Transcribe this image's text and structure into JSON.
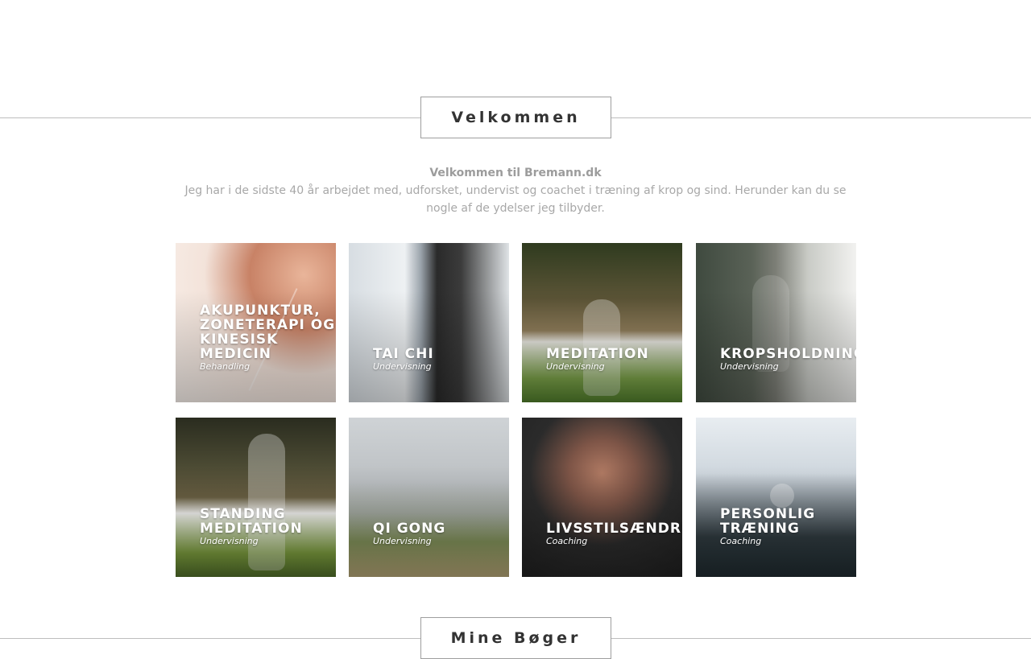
{
  "welcome": {
    "heading": "Velkommen",
    "lead": "Velkommen til Bremann.dk",
    "text": "Jeg har i de sidste 40 år arbejdet med, udforsket, undervist og coachet i træning af krop og sind. Herunder kan du se nogle af de ydelser jeg tilbyder."
  },
  "services": [
    {
      "title": "AKUPUNKTUR,\nZONETERAPI OG\nKINESISK\nMEDICIN",
      "subtitle": "Behandling"
    },
    {
      "title": "TAI CHI",
      "subtitle": "Undervisning"
    },
    {
      "title": "MEDITATION",
      "subtitle": "Undervisning"
    },
    {
      "title": "KROPSHOLDNING",
      "subtitle": "Undervisning"
    },
    {
      "title": "STANDING\nMEDITATION",
      "subtitle": "Undervisning"
    },
    {
      "title": "QI GONG",
      "subtitle": "Undervisning"
    },
    {
      "title": "LIVSSTILSÆNDRINGER",
      "subtitle": "Coaching"
    },
    {
      "title": "PERSONLIG\nTRÆNING",
      "subtitle": "Coaching"
    }
  ],
  "books": {
    "heading": "Mine Bøger"
  }
}
